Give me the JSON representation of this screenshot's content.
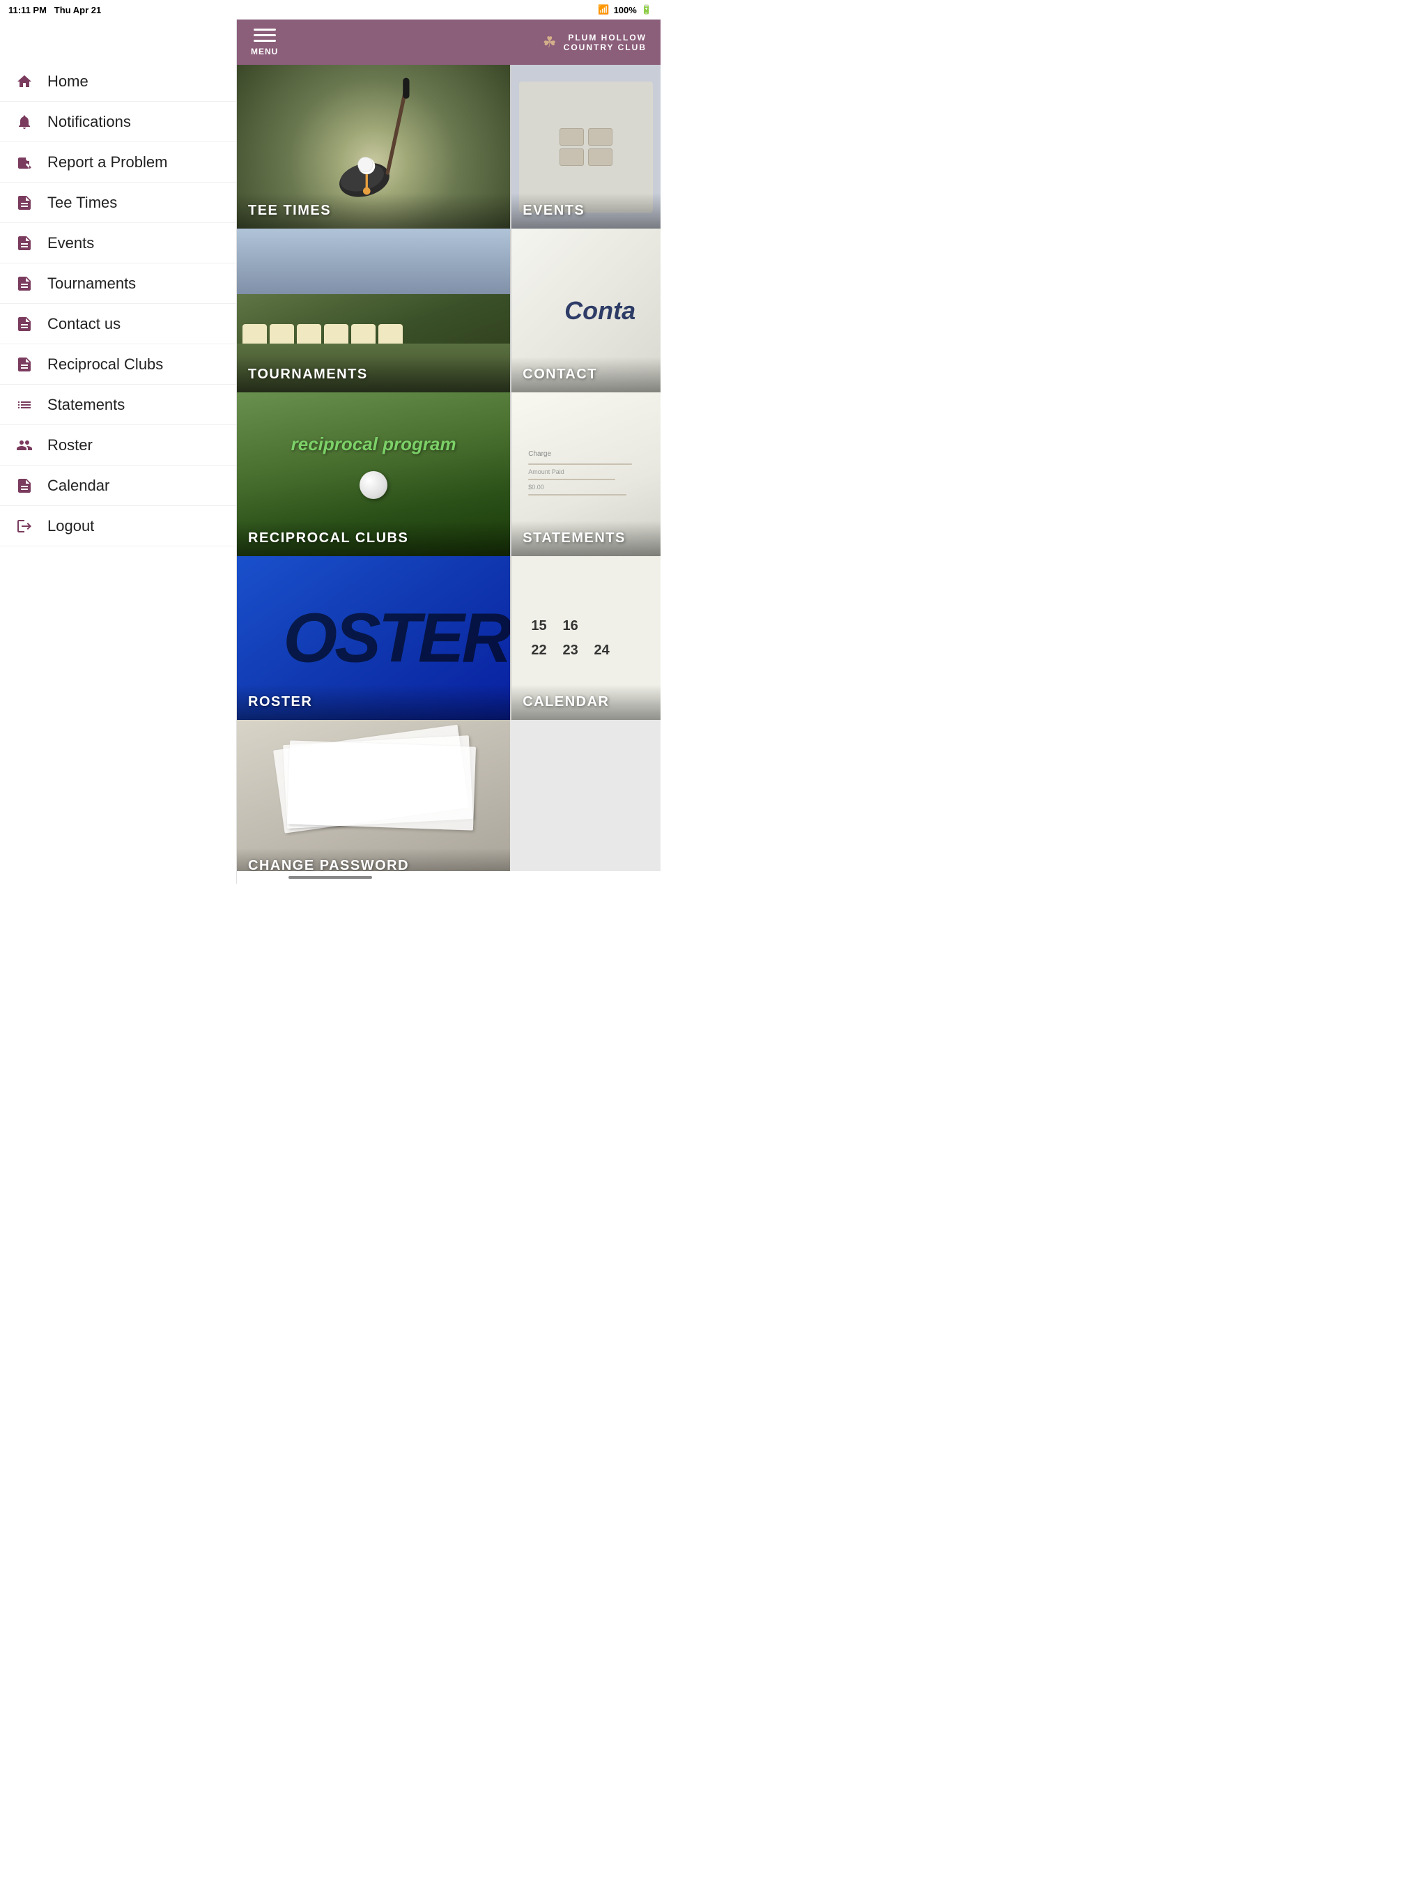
{
  "statusBar": {
    "time": "11:11 PM",
    "date": "Thu Apr 21",
    "wifi": "WiFi",
    "battery": "100%"
  },
  "sidebar": {
    "items": [
      {
        "id": "home",
        "label": "Home",
        "icon": "home"
      },
      {
        "id": "notifications",
        "label": "Notifications",
        "icon": "bell"
      },
      {
        "id": "report-problem",
        "label": "Report a Problem",
        "icon": "wrench"
      },
      {
        "id": "tee-times",
        "label": "Tee Times",
        "icon": "doc"
      },
      {
        "id": "events",
        "label": "Events",
        "icon": "doc"
      },
      {
        "id": "tournaments",
        "label": "Tournaments",
        "icon": "doc"
      },
      {
        "id": "contact-us",
        "label": "Contact us",
        "icon": "doc"
      },
      {
        "id": "reciprocal-clubs",
        "label": "Reciprocal Clubs",
        "icon": "doc"
      },
      {
        "id": "statements",
        "label": "Statements",
        "icon": "list"
      },
      {
        "id": "roster",
        "label": "Roster",
        "icon": "person"
      },
      {
        "id": "calendar",
        "label": "Calendar",
        "icon": "doc"
      },
      {
        "id": "logout",
        "label": "Logout",
        "icon": "exit"
      }
    ]
  },
  "header": {
    "menu_label": "MENU",
    "club_name_line1": "PLUM HOLLOW",
    "club_name_line2": "COUNTRY CLUB"
  },
  "grid": {
    "tiles": [
      {
        "id": "tee-times",
        "label": "TEE TIMES"
      },
      {
        "id": "events",
        "label": "EVENTS"
      },
      {
        "id": "tournaments",
        "label": "TOURNAMENTS"
      },
      {
        "id": "contact",
        "label": "CONTACT"
      },
      {
        "id": "reciprocal",
        "label": "RECIPROCAL CLUBS",
        "subtext": "reciprocal program"
      },
      {
        "id": "statements",
        "label": "STATEMENTS"
      },
      {
        "id": "roster",
        "label": "ROSTER",
        "big_text": "ROSTER"
      },
      {
        "id": "calendar",
        "label": "CALENDAR",
        "numbers": [
          "15",
          "16",
          "",
          "22",
          "23",
          "24",
          ""
        ]
      },
      {
        "id": "change-password",
        "label": "CHANGE PASSWORD"
      }
    ]
  }
}
